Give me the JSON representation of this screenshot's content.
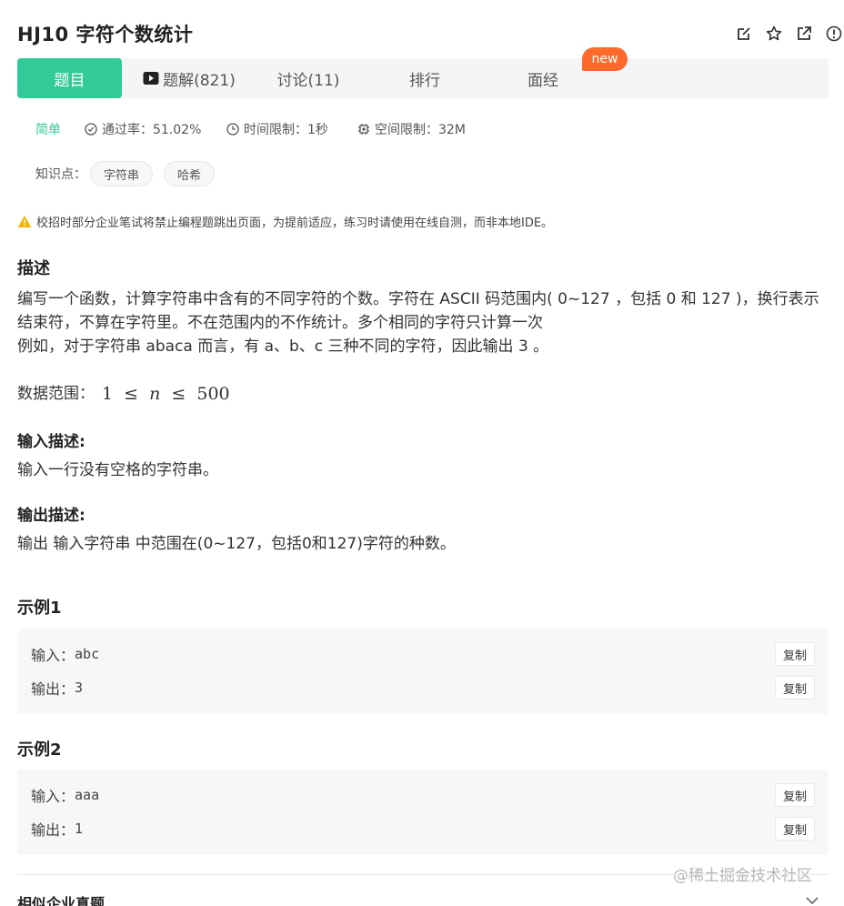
{
  "header": {
    "title": "HJ10  字符个数统计",
    "icons": [
      "edit-icon",
      "star-icon",
      "external-link-icon",
      "info-icon"
    ]
  },
  "tabs": [
    {
      "label": "题目",
      "active": true
    },
    {
      "label": "题解(821)",
      "icon": "video-icon"
    },
    {
      "label": "讨论(11)"
    },
    {
      "label": "排行"
    },
    {
      "label": "面经",
      "badge": "new"
    }
  ],
  "meta": {
    "difficulty": "简单",
    "pass_rate": "通过率：51.02%",
    "time_limit": "时间限制：1秒",
    "space_limit": "空间限制：32M"
  },
  "knowledge": {
    "label": "知识点：",
    "tags": [
      "字符串",
      "哈希"
    ]
  },
  "warning": "校招时部分企业笔试将禁止编程题跳出页面，为提前适应，练习时请使用在线自测，而非本地IDE。",
  "description": {
    "heading": "描述",
    "line1": "编写一个函数，计算字符串中含有的不同字符的个数。字符在 ASCII 码范围内( 0~127 ，包括 0 和 127 )，换行表示",
    "line2": "结束符，不算在字符里。不在范围内的不作统计。多个相同的字符只计算一次",
    "line3": "例如，对于字符串 abaca 而言，有 a、b、c 三种不同的字符，因此输出 3 。",
    "range_label": "数据范围：",
    "range_low": "1",
    "range_var": "n",
    "range_high": "500"
  },
  "input_desc": {
    "heading": "输入描述:",
    "text": "输入一行没有空格的字符串。"
  },
  "output_desc": {
    "heading": "输出描述:",
    "text": "输出 输入字符串 中范围在(0~127，包括0和127)字符的种数。"
  },
  "examples": [
    {
      "heading": "示例1",
      "input_label": "输入：",
      "input": "abc",
      "output_label": "输出：",
      "output": "3",
      "copy": "复制"
    },
    {
      "heading": "示例2",
      "input_label": "输入：",
      "input": "aaa",
      "output_label": "输出：",
      "output": "1",
      "copy": "复制"
    }
  ],
  "bottom": {
    "section_title": "相似企业真题",
    "watermark": "@稀土掘金技术社区"
  },
  "colors": {
    "accent": "#32ca99",
    "badge": "#ff6a2c",
    "warning": "#f5b300"
  }
}
